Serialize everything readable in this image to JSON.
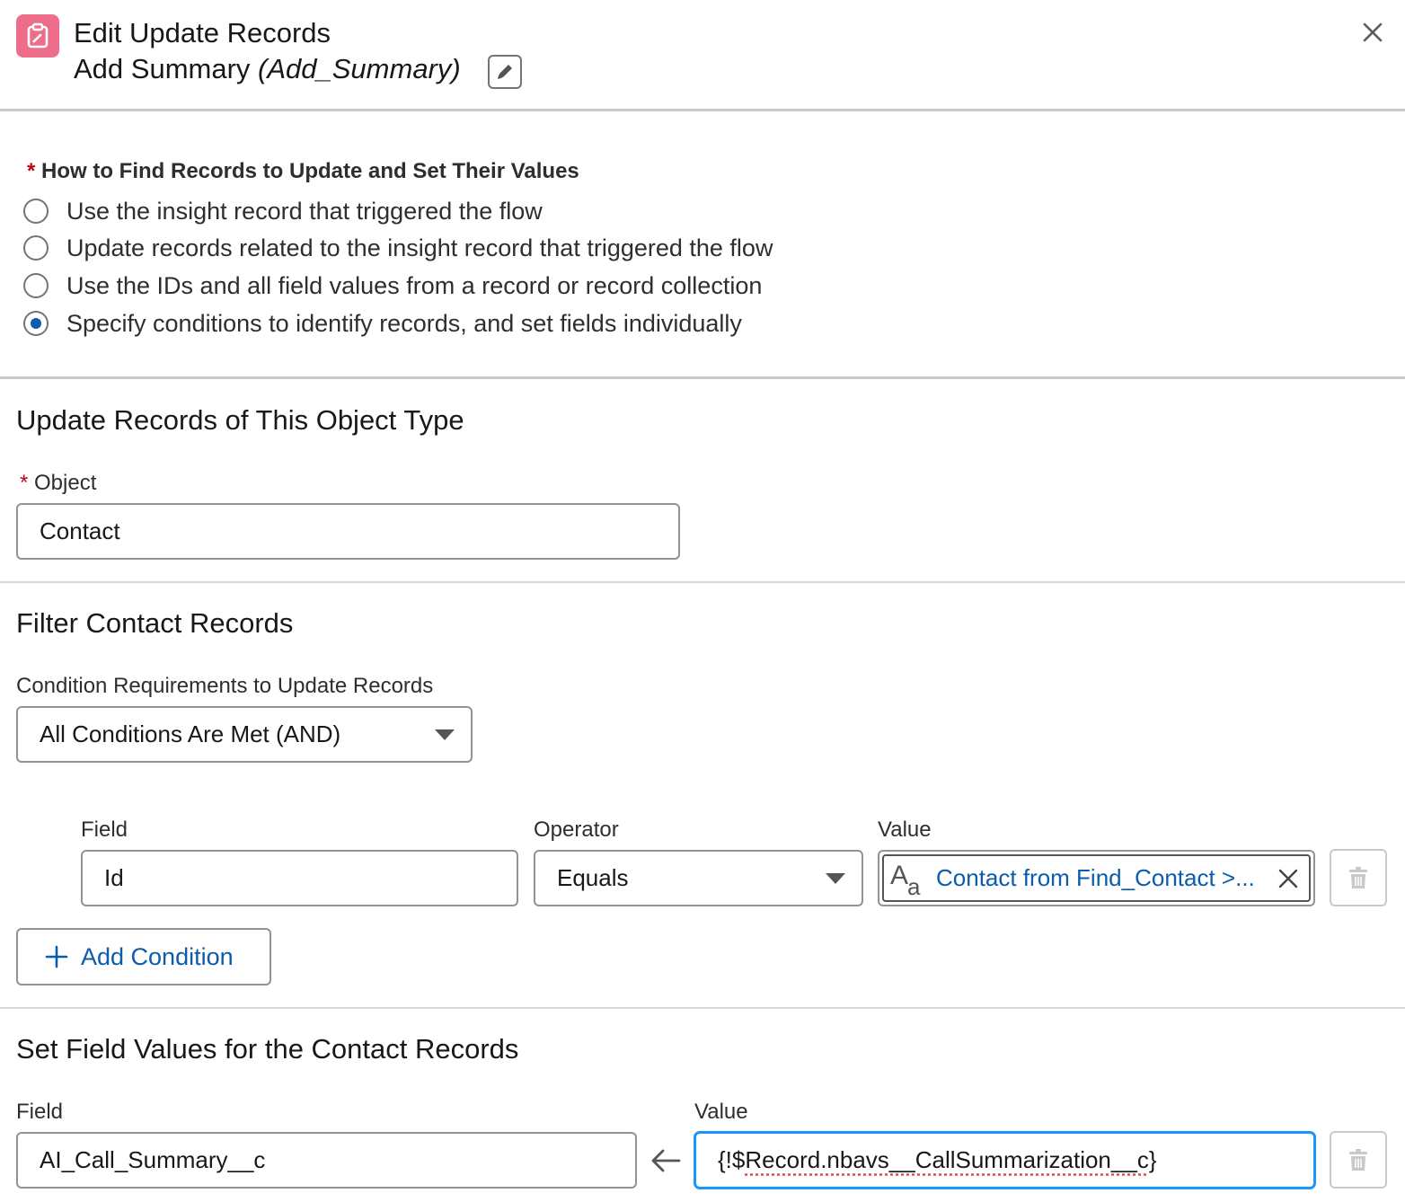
{
  "header": {
    "title": "Edit Update Records",
    "element_label": "Add Summary",
    "element_api": "(Add_Summary)",
    "icon": "clipboard-edit-icon"
  },
  "find_records": {
    "required_marker": "*",
    "label": "How to Find Records to Update and Set Their Values",
    "options": [
      {
        "label": "Use the insight record that triggered the flow",
        "selected": false
      },
      {
        "label": "Update records related to the insight record that triggered the flow",
        "selected": false
      },
      {
        "label": "Use the IDs and all field values from a record or record collection",
        "selected": false
      },
      {
        "label": "Specify conditions to identify records, and set fields individually",
        "selected": true
      }
    ]
  },
  "object_section": {
    "title": "Update Records of This Object Type",
    "object_label": "Object",
    "object_value": "Contact"
  },
  "filter_section": {
    "title": "Filter Contact Records",
    "condition_req_label": "Condition Requirements to Update Records",
    "condition_req_value": "All Conditions Are Met (AND)",
    "columns": {
      "field": "Field",
      "operator": "Operator",
      "value": "Value"
    },
    "condition": {
      "field": "Id",
      "operator": "Equals",
      "value": "Contact from Find_Contact >..."
    },
    "add_condition_label": "Add Condition"
  },
  "set_values_section": {
    "title": "Set Field Values for the Contact Records",
    "field_label": "Field",
    "value_label": "Value",
    "row": {
      "field": "AI_Call_Summary__c",
      "value_prefix": "{!$",
      "value_merge": "Record.nbavs__CallSummarization__c",
      "value_suffix": "}"
    }
  },
  "colors": {
    "icon_bg": "#ee6d8a",
    "brand_blue": "#0b5cab",
    "focus_blue": "#1b96ff",
    "required_red": "#ba0517"
  }
}
